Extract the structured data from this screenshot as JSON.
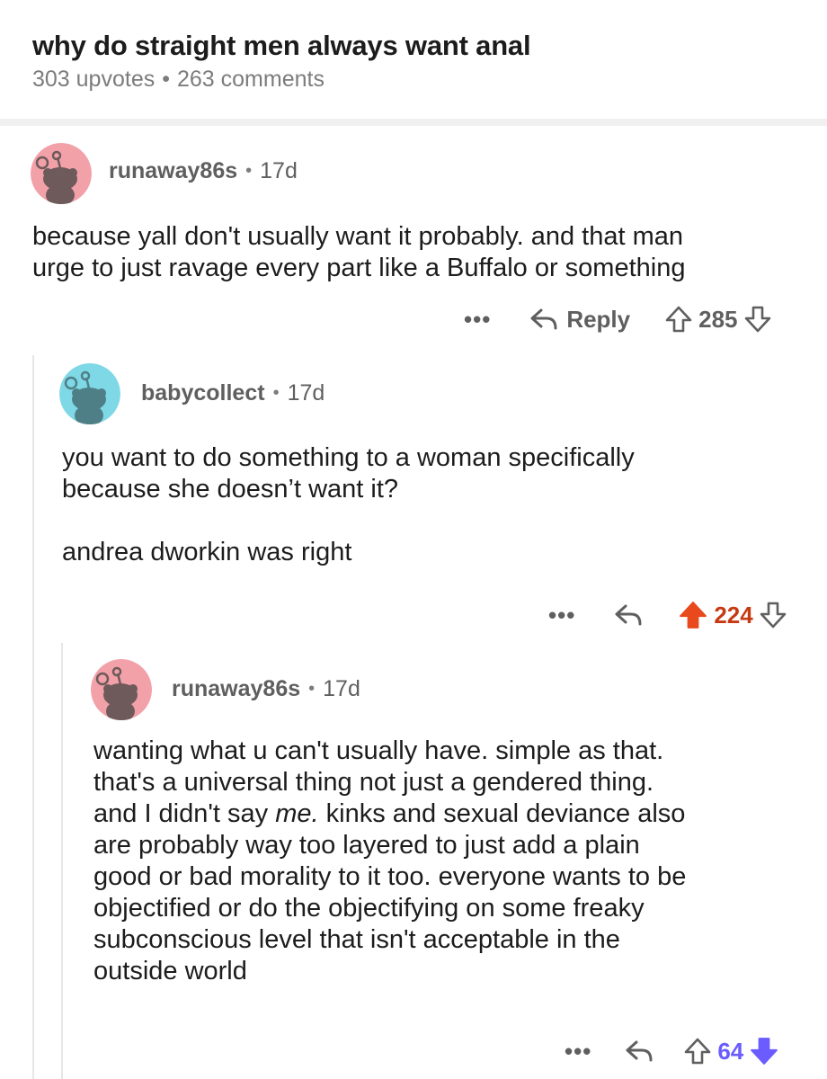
{
  "post": {
    "title": "why do straight men always want anal",
    "upvotes": "303 upvotes",
    "separator": "•",
    "comments": "263 comments"
  },
  "colors": {
    "upvote_active": "#e8491d",
    "downvote_active": "#6a5cff",
    "avatar_pink": "#f2a1a9",
    "avatar_teal": "#7fd8e6"
  },
  "comments": [
    {
      "username": "runaway86s",
      "separator": "•",
      "age": "17d",
      "avatar": "snoo-avatar-pink",
      "lines": [
        "because yall don't usually want it probably. and that man",
        "urge to just ravage every part like a Buffalo or something"
      ],
      "more": "•••",
      "reply_label": "Reply",
      "score": "285",
      "vote_state": "none"
    },
    {
      "username": "babycollect",
      "separator": "•",
      "age": "17d",
      "avatar": "snoo-avatar-teal",
      "paragraphs": [
        [
          "you want to do something to a woman specifically",
          "because she doesn’t want it?"
        ],
        [
          "andrea dworkin was right"
        ]
      ],
      "more": "•••",
      "score": "224",
      "vote_state": "upvoted"
    },
    {
      "username": "runaway86s",
      "separator": "•",
      "age": "17d",
      "avatar": "snoo-avatar-pink",
      "lines": [
        "wanting what u can't usually have. simple as that.",
        "that's a universal thing not just a gendered thing.",
        "and I didn't say",
        "me.",
        " kinks and sexual deviance also",
        "are probably way too layered to just add a plain",
        "good or bad morality to it too. everyone wants to be",
        "objectified or do the objectifying on some freaky",
        "subconscious level that isn't acceptable in the",
        "outside world"
      ],
      "more": "•••",
      "score": "64",
      "vote_state": "downvoted"
    }
  ]
}
